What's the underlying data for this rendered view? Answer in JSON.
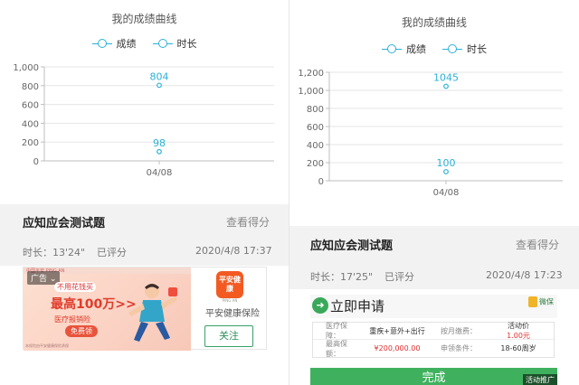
{
  "left": {
    "chart_title": "我的成绩曲线",
    "quiz_title": "应知应会测试题",
    "view_score": "查看得分",
    "duration": "时长：13'24\"",
    "status": "已评分",
    "datetime": "2020/4/8 17:37",
    "ad": {
      "badge": "广告",
      "top_small": "中国平安 PING AN",
      "slogan": "不用花钱买",
      "headline": "最高100万>>",
      "subline": "医疗报销险",
      "free": "免费领",
      "fine_print": "本保险由平安健康保险承保",
      "logo_text": "平安健康",
      "logo_caption": "PING AN",
      "name": "平安健康保险",
      "follow": "关注"
    }
  },
  "right": {
    "chart_title": "我的成绩曲线",
    "quiz_title": "应知应会测试题",
    "view_score": "查看得分",
    "duration": "时长：17'25\"",
    "status": "已评分",
    "datetime": "2020/4/8 17:23",
    "ad": {
      "apply": "立即申请",
      "logo": "微保",
      "rows": [
        {
          "k1": "医疗保障：",
          "v1": "重疾+意外+出行",
          "k2": "按月缴费：",
          "v2": "活动价 1.00元"
        },
        {
          "k1": "最高保额：",
          "v1": "¥200,000.00",
          "k2": "申领条件：",
          "v2": "18-60周岁"
        }
      ],
      "done": "完成",
      "promo": "活动推广"
    }
  },
  "legend": {
    "score": "成绩",
    "duration": "时长"
  },
  "colors": {
    "line": "#2bb0d6",
    "axis": "#bfbfbf",
    "grid": "#e6e6e6",
    "green": "#3fb15e",
    "red": "#e03030"
  },
  "chart_data": [
    {
      "type": "line",
      "title": "我的成绩曲线",
      "categories": [
        "04/08"
      ],
      "series": [
        {
          "name": "成绩",
          "values": [
            98
          ]
        },
        {
          "name": "时长",
          "values": [
            804
          ]
        }
      ],
      "yticks": [
        "0",
        "200",
        "400",
        "600",
        "800",
        "1,000"
      ],
      "ylim": [
        0,
        1000
      ],
      "grid": true,
      "legend": "top-center"
    },
    {
      "type": "line",
      "title": "我的成绩曲线",
      "categories": [
        "04/08"
      ],
      "series": [
        {
          "name": "成绩",
          "values": [
            100
          ]
        },
        {
          "name": "时长",
          "values": [
            1045
          ]
        }
      ],
      "yticks": [
        "0",
        "200",
        "400",
        "600",
        "800",
        "1,000",
        "1,200"
      ],
      "ylim": [
        0,
        1200
      ],
      "grid": true,
      "legend": "top-center"
    }
  ]
}
